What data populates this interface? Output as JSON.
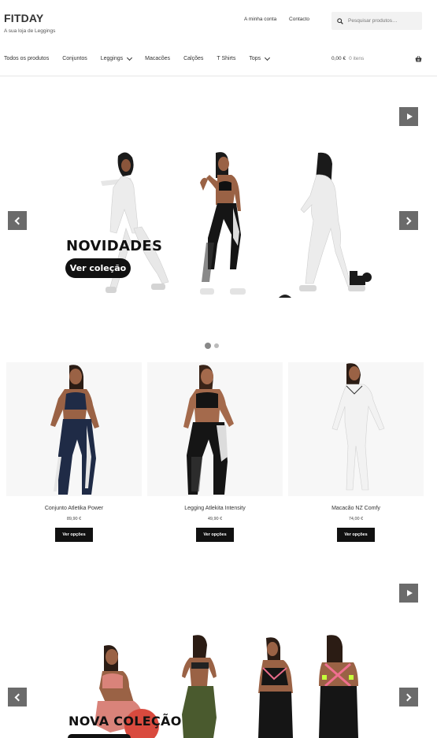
{
  "brand": {
    "title": "FITDAY",
    "tagline": "A sua loja de Leggings"
  },
  "topnav": {
    "account": "A minha conta",
    "contact": "Contacto"
  },
  "search": {
    "placeholder": "Pesquisar produtos…"
  },
  "mainnav": {
    "items": [
      {
        "label": "Todos os produtos",
        "dropdown": false
      },
      {
        "label": "Conjuntos",
        "dropdown": false
      },
      {
        "label": "Leggings",
        "dropdown": true
      },
      {
        "label": "Macacões",
        "dropdown": false
      },
      {
        "label": "Calções",
        "dropdown": false
      },
      {
        "label": "T Shirts",
        "dropdown": false
      },
      {
        "label": "Tops",
        "dropdown": true
      }
    ]
  },
  "cart": {
    "total": "0,00 €",
    "count": "0 itens"
  },
  "slider1": {
    "title": "NOVIDADES",
    "button": "Ver coleção",
    "active_dot": 1,
    "dots": 2
  },
  "products": [
    {
      "name": "Conjunto Atletika Power",
      "price": "89,90 €",
      "button": "Ver opções"
    },
    {
      "name": "Legging Atlekita Intensity",
      "price": "49,90 €",
      "button": "Ver opções"
    },
    {
      "name": "Macacão NZ Comfy",
      "price": "74,00 €",
      "button": "Ver opções"
    }
  ],
  "slider2": {
    "title": "NOVA COLEÇÃO"
  },
  "colors": {
    "accent": "#111111",
    "control": "#6b6b6b",
    "skin": "#a46a4c"
  }
}
